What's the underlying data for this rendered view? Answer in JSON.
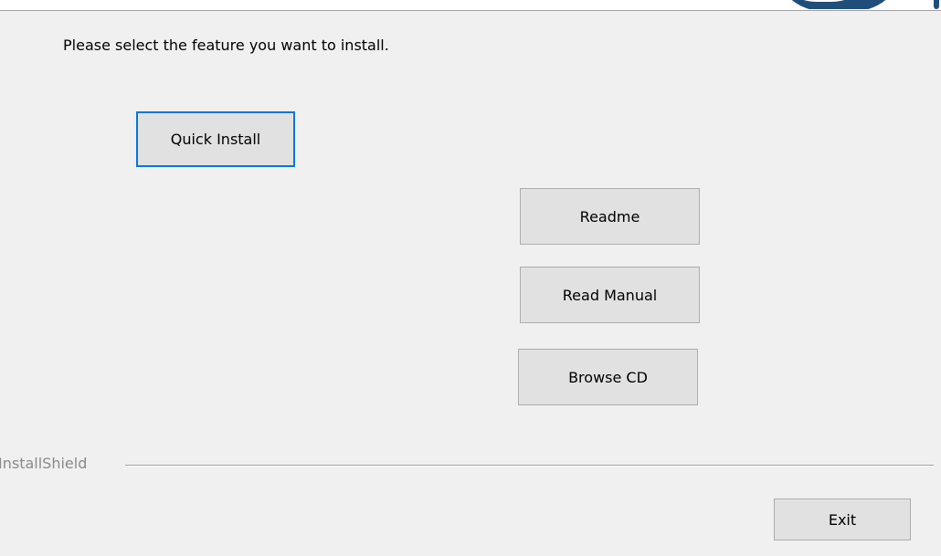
{
  "dialog": {
    "instruction": "Please select the feature you want to install.",
    "buttons": {
      "quick_install": "Quick Install",
      "readme": "Readme",
      "read_manual": "Read Manual",
      "browse_cd": "Browse CD",
      "exit": "Exit"
    },
    "footer_brand": "InstallShield"
  },
  "colors": {
    "background": "#f0f0f0",
    "button_face": "#e1e1e1",
    "focus_border": "#0078d7",
    "logo_blue": "#1f4e7a"
  }
}
